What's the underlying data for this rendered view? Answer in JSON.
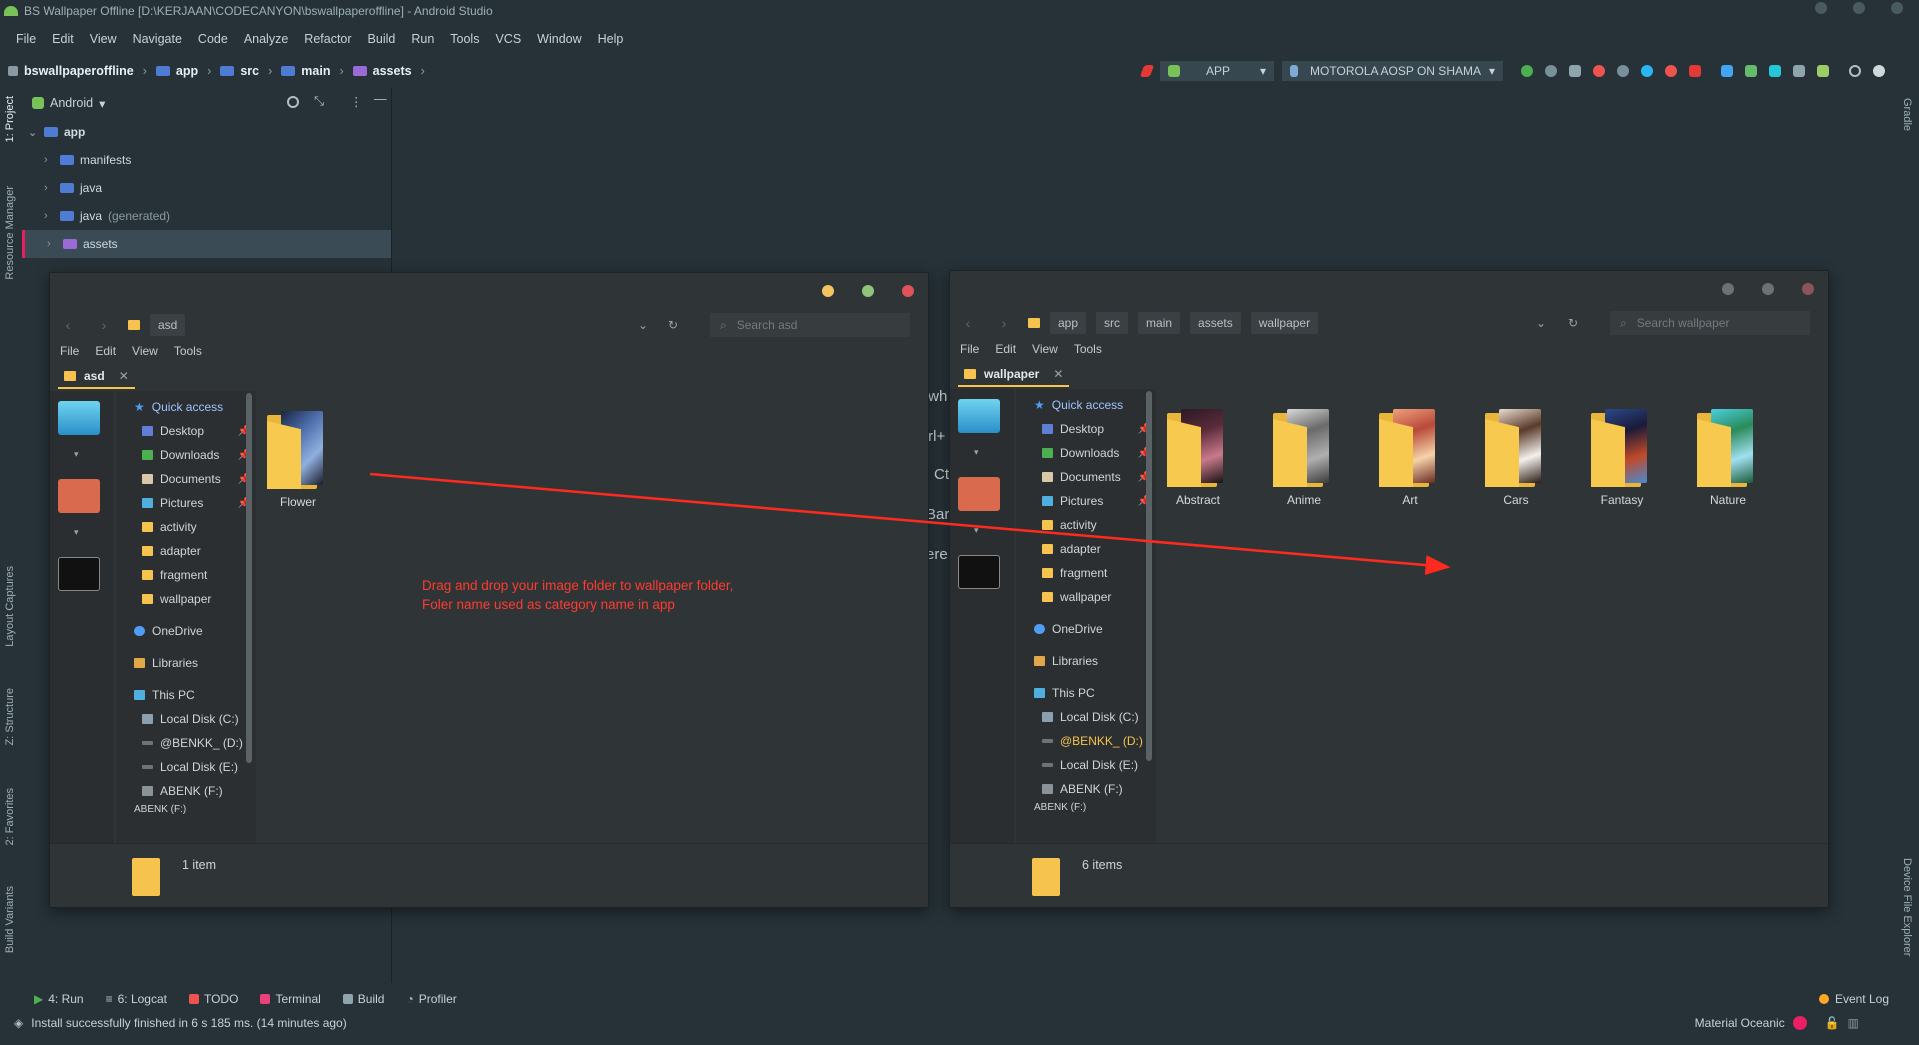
{
  "window": {
    "title": "BS Wallpaper Offline [D:\\KERJAAN\\CODECANYON\\bswallpaperoffline] - Android Studio"
  },
  "menu": [
    "File",
    "Edit",
    "View",
    "Navigate",
    "Code",
    "Analyze",
    "Refactor",
    "Build",
    "Run",
    "Tools",
    "VCS",
    "Window",
    "Help"
  ],
  "breadcrumb": [
    "bswallpaperoffline",
    "app",
    "src",
    "main",
    "assets"
  ],
  "run_config": {
    "module": "APP",
    "device": "MOTOROLA AOSP ON SHAMA"
  },
  "left_tool_tabs": [
    "1: Project",
    "Resource Manager",
    "Layout Captures",
    "Z: Structure",
    "2: Favorites",
    "Build Variants"
  ],
  "right_tool_tabs": [
    "Gradle",
    "Device File Explorer"
  ],
  "project_panel": {
    "view": "Android",
    "tree": [
      {
        "label": "app",
        "depth": 0
      },
      {
        "label": "manifests",
        "depth": 1
      },
      {
        "label": "java",
        "depth": 1
      },
      {
        "label": "java",
        "suffix": "(generated)",
        "depth": 1
      },
      {
        "label": "assets",
        "depth": 1,
        "selected": true
      }
    ]
  },
  "bottom_tabs": [
    "4: Run",
    "6: Logcat",
    "TODO",
    "Terminal",
    "Build",
    "Profiler"
  ],
  "event_log": "Event Log",
  "status": {
    "message": "Install successfully finished in 6 s 185 ms. (14 minutes ago)",
    "theme": "Material Oceanic"
  },
  "peek_text": [
    "/wh",
    "trl+",
    "Ct",
    "Bar",
    "ere"
  ],
  "explorer_left": {
    "path": [
      "asd"
    ],
    "search_placeholder": "Search asd",
    "menu": [
      "File",
      "Edit",
      "View",
      "Tools"
    ],
    "tab": "asd",
    "nav": {
      "quick_access": "Quick access",
      "items": [
        "Desktop",
        "Downloads",
        "Documents",
        "Pictures",
        "activity",
        "adapter",
        "fragment",
        "wallpaper"
      ],
      "onedrive": "OneDrive",
      "libraries": "Libraries",
      "this_pc": "This PC",
      "drives": [
        "Local Disk (C:)",
        "@BENKK_ (D:)",
        "Local Disk (E:)",
        "ABENK (F:)"
      ],
      "cut_off": "ABENK (F:)"
    },
    "folders": [
      "Flower"
    ],
    "item_count": "1 item"
  },
  "explorer_right": {
    "path": [
      "app",
      "src",
      "main",
      "assets",
      "wallpaper"
    ],
    "search_placeholder": "Search wallpaper",
    "menu": [
      "File",
      "Edit",
      "View",
      "Tools"
    ],
    "tab": "wallpaper",
    "nav": {
      "quick_access": "Quick access",
      "items": [
        "Desktop",
        "Downloads",
        "Documents",
        "Pictures",
        "activity",
        "adapter",
        "fragment",
        "wallpaper"
      ],
      "onedrive": "OneDrive",
      "libraries": "Libraries",
      "this_pc": "This PC",
      "drives": [
        "Local Disk (C:)",
        "@BENKK_ (D:)",
        "Local Disk (E:)",
        "ABENK (F:)"
      ],
      "cut_off": "ABENK (F:)"
    },
    "folders": [
      "Abstract",
      "Anime",
      "Art",
      "Cars",
      "Fantasy",
      "Nature"
    ],
    "item_count": "6 items"
  },
  "annotation": {
    "line1": "Drag and drop your image folder to wallpaper folder,",
    "line2": "Foler name used as category name in app",
    "color": "#ff2a1f"
  },
  "colors": {
    "ide_bg": "#263238",
    "explorer_bg": "#2f3436",
    "folder_yellow": "#f5c34e",
    "accent_blue": "#4f7bd4"
  }
}
